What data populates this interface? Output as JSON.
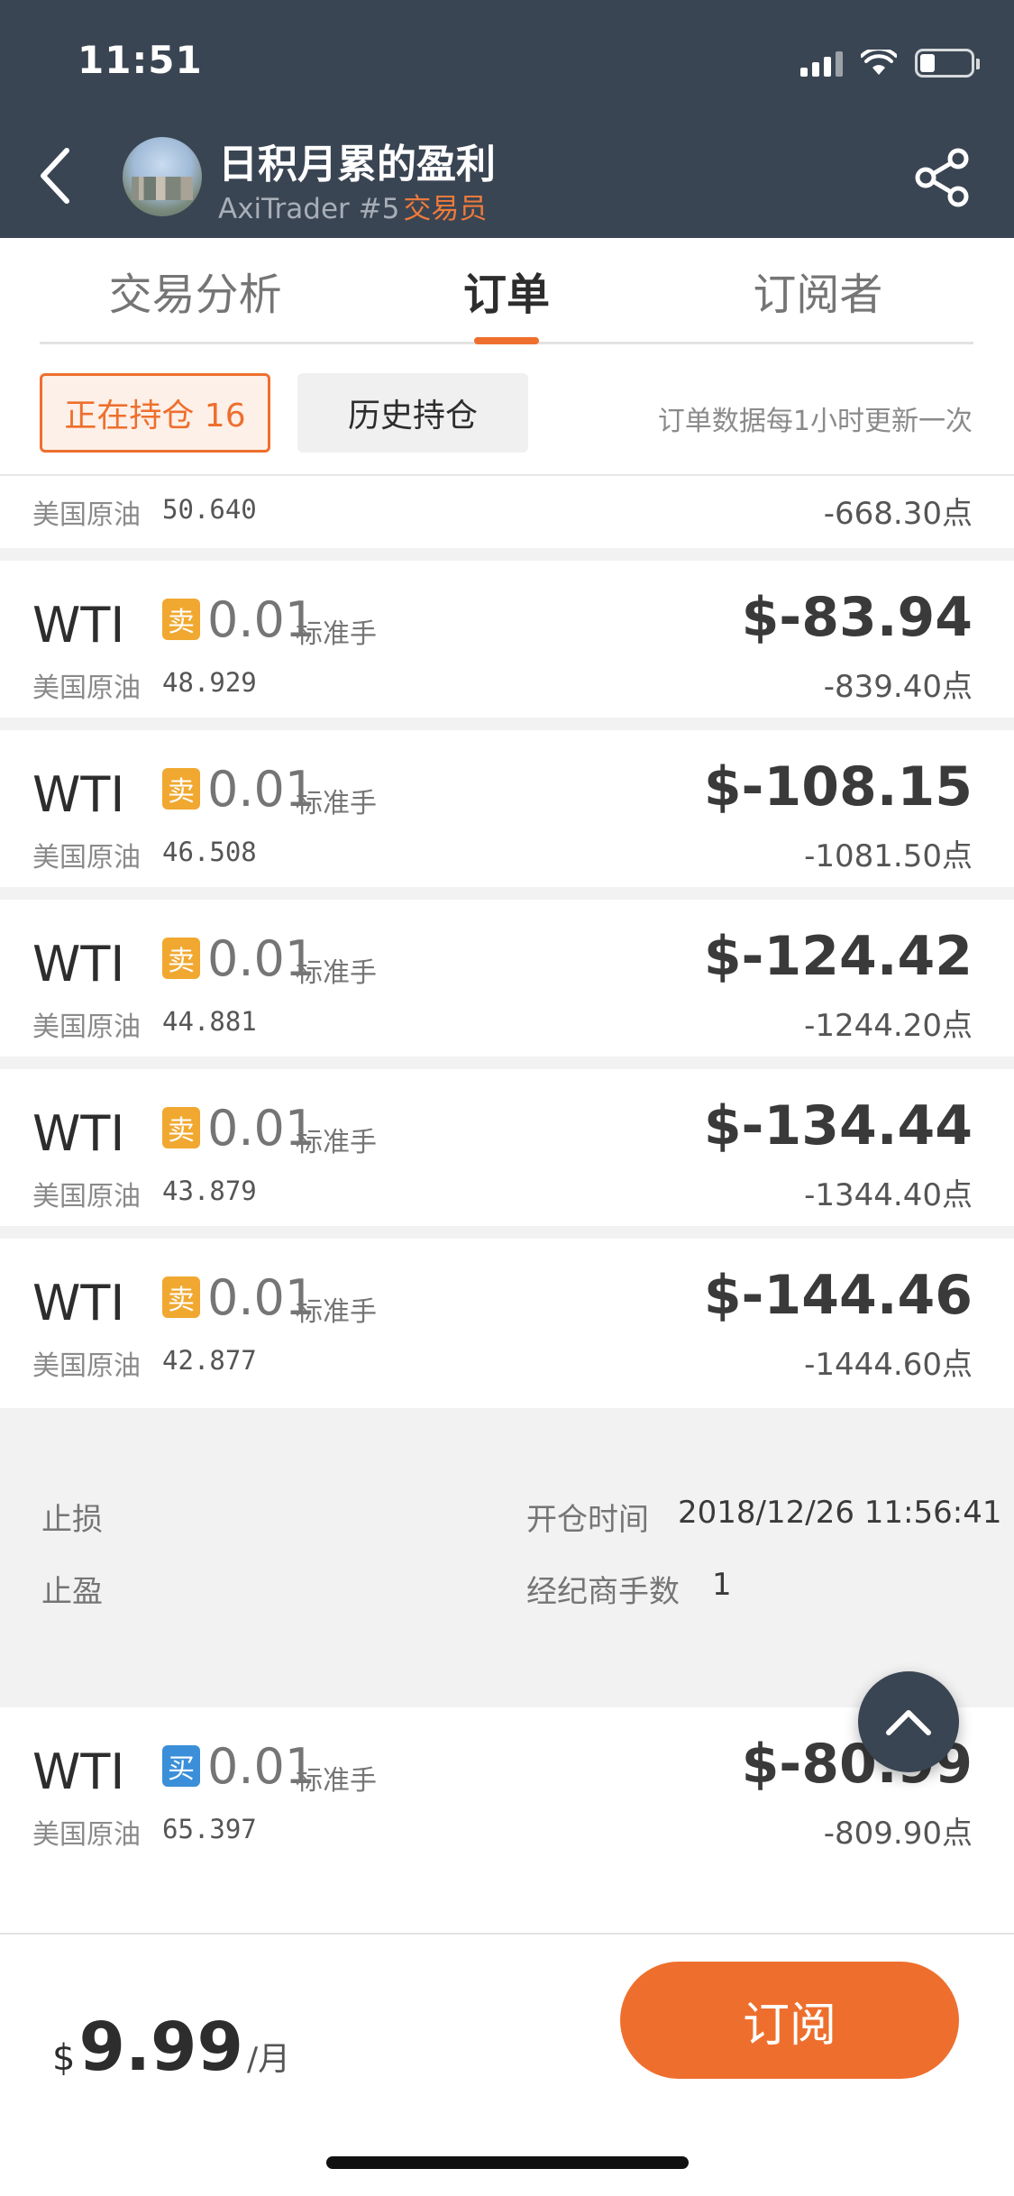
{
  "status_bar": {
    "time": "11:51"
  },
  "header": {
    "trader_name": "日积月累的盈利",
    "trader_sub": "AxiTrader #5",
    "trader_role": "交易员"
  },
  "tabs": [
    {
      "label": "交易分析",
      "active": false
    },
    {
      "label": "订单",
      "active": true
    },
    {
      "label": "订阅者",
      "active": false
    }
  ],
  "filters": {
    "open_label": "正在持仓 16",
    "history_label": "历史持仓",
    "update_note": "订单数据每1小时更新一次"
  },
  "partial_order": {
    "asset": "美国原油",
    "open_price": "50.640",
    "points": "-668.30点"
  },
  "orders": [
    {
      "symbol": "WTI",
      "side": "卖",
      "lot": "0.01",
      "unit": "标准手",
      "asset": "美国原油",
      "open_price": "48.929",
      "pnl": "$-83.94",
      "points": "-839.40点"
    },
    {
      "symbol": "WTI",
      "side": "卖",
      "lot": "0.01",
      "unit": "标准手",
      "asset": "美国原油",
      "open_price": "46.508",
      "pnl": "$-108.15",
      "points": "-1081.50点"
    },
    {
      "symbol": "WTI",
      "side": "卖",
      "lot": "0.01",
      "unit": "标准手",
      "asset": "美国原油",
      "open_price": "44.881",
      "pnl": "$-124.42",
      "points": "-1244.20点"
    },
    {
      "symbol": "WTI",
      "side": "卖",
      "lot": "0.01",
      "unit": "标准手",
      "asset": "美国原油",
      "open_price": "43.879",
      "pnl": "$-134.44",
      "points": "-1344.40点"
    },
    {
      "symbol": "WTI",
      "side": "卖",
      "lot": "0.01",
      "unit": "标准手",
      "asset": "美国原油",
      "open_price": "42.877",
      "pnl": "$-144.46",
      "points": "-1444.60点"
    }
  ],
  "detail": {
    "stop_loss_label": "止损",
    "take_profit_label": "止盈",
    "open_time_label": "开仓时间",
    "open_time_value": "2018/12/26 11:56:41",
    "broker_lots_label": "经纪商手数",
    "broker_lots_value": "1"
  },
  "last_order": {
    "symbol": "WTI",
    "side": "买",
    "lot": "0.01",
    "unit": "标准手",
    "asset": "美国原油",
    "open_price": "65.397",
    "pnl": "$-80.99",
    "points": "-809.90点"
  },
  "bottom": {
    "currency": "$",
    "price": "9.99",
    "period": "/月",
    "subscribe_label": "订阅"
  },
  "colors": {
    "accent": "#ee6f2d",
    "header_bg": "#3a4553",
    "sell_badge": "#f0a830",
    "buy_badge": "#3b8fd9"
  },
  "icons": {
    "back": "chevron-left-icon",
    "share": "share-icon",
    "scroll_top": "chevron-up-icon"
  }
}
